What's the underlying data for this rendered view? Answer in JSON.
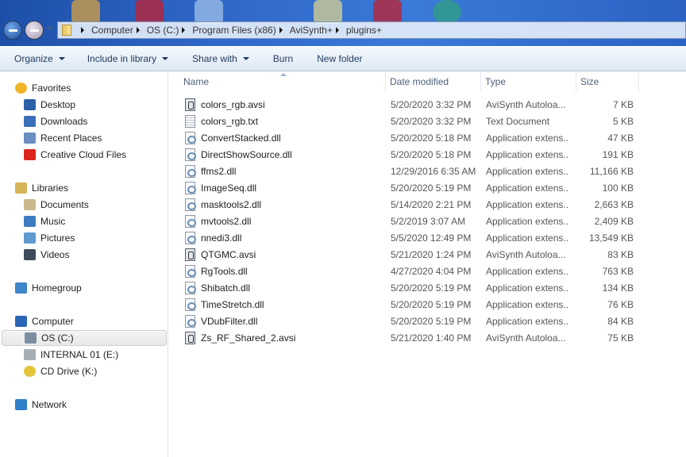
{
  "address": {
    "crumbs": [
      "Computer",
      "OS (C:)",
      "Program Files (x86)",
      "AviSynth+",
      "plugins+"
    ]
  },
  "toolbar": {
    "organize": "Organize",
    "include": "Include in library",
    "share": "Share with",
    "burn": "Burn",
    "new_folder": "New folder"
  },
  "sidebar": [
    {
      "label": "Favorites",
      "icon": "star-icon",
      "level": 0,
      "color": "#f0b429"
    },
    {
      "label": "Desktop",
      "icon": "desktop-icon",
      "level": 1,
      "color": "#2c5fa8"
    },
    {
      "label": "Downloads",
      "icon": "downloads-folder-icon",
      "level": 1,
      "color": "#3a6fb8"
    },
    {
      "label": "Recent Places",
      "icon": "recent-places-icon",
      "level": 1,
      "color": "#6a8fc0"
    },
    {
      "label": "Creative Cloud Files",
      "icon": "creative-cloud-icon",
      "level": 1,
      "color": "#d9251c"
    },
    {
      "label": "Libraries",
      "icon": "libraries-icon",
      "level": 0,
      "color": "#d7b45a",
      "gap": true
    },
    {
      "label": "Documents",
      "icon": "documents-icon",
      "level": 1,
      "color": "#c9b98a"
    },
    {
      "label": "Music",
      "icon": "music-icon",
      "level": 1,
      "color": "#3e7cc2"
    },
    {
      "label": "Pictures",
      "icon": "pictures-icon",
      "level": 1,
      "color": "#5f9bd0"
    },
    {
      "label": "Videos",
      "icon": "videos-icon",
      "level": 1,
      "color": "#3d4a5a"
    },
    {
      "label": "Homegroup",
      "icon": "homegroup-icon",
      "level": 0,
      "color": "#3d86c9",
      "gap": true
    },
    {
      "label": "Computer",
      "icon": "computer-icon",
      "level": 0,
      "color": "#2a64b5",
      "gap": true
    },
    {
      "label": "OS (C:)",
      "icon": "os-drive-icon",
      "level": 1,
      "color": "#7d8ea0",
      "selected": true
    },
    {
      "label": "INTERNAL 01 (E:)",
      "icon": "hard-drive-icon",
      "level": 1,
      "color": "#a7adb5"
    },
    {
      "label": "CD Drive (K:)",
      "icon": "cd-drive-icon",
      "level": 1,
      "color": "#e3c43b"
    },
    {
      "label": "Network",
      "icon": "network-icon",
      "level": 0,
      "color": "#2f7fc9",
      "gap": true
    }
  ],
  "columns": {
    "name": "Name",
    "date": "Date modified",
    "type": "Type",
    "size": "Size"
  },
  "files": [
    {
      "name": "colors_rgb.avsi",
      "date": "5/20/2020 3:32 PM",
      "type": "AviSynth Autoloa...",
      "size": "7 KB",
      "kind": "avsi"
    },
    {
      "name": "colors_rgb.txt",
      "date": "5/20/2020 3:32 PM",
      "type": "Text Document",
      "size": "5 KB",
      "kind": "txt"
    },
    {
      "name": "ConvertStacked.dll",
      "date": "5/20/2020 5:18 PM",
      "type": "Application extens...",
      "size": "47 KB",
      "kind": "dll"
    },
    {
      "name": "DirectShowSource.dll",
      "date": "5/20/2020 5:18 PM",
      "type": "Application extens...",
      "size": "191 KB",
      "kind": "dll"
    },
    {
      "name": "ffms2.dll",
      "date": "12/29/2016 6:35 AM",
      "type": "Application extens...",
      "size": "11,166 KB",
      "kind": "dll"
    },
    {
      "name": "ImageSeq.dll",
      "date": "5/20/2020 5:19 PM",
      "type": "Application extens...",
      "size": "100 KB",
      "kind": "dll"
    },
    {
      "name": "masktools2.dll",
      "date": "5/14/2020 2:21 PM",
      "type": "Application extens...",
      "size": "2,663 KB",
      "kind": "dll"
    },
    {
      "name": "mvtools2.dll",
      "date": "5/2/2019 3:07 AM",
      "type": "Application extens...",
      "size": "2,409 KB",
      "kind": "dll"
    },
    {
      "name": "nnedi3.dll",
      "date": "5/5/2020 12:49 PM",
      "type": "Application extens...",
      "size": "13,549 KB",
      "kind": "dll"
    },
    {
      "name": "QTGMC.avsi",
      "date": "5/21/2020 1:24 PM",
      "type": "AviSynth Autoloa...",
      "size": "83 KB",
      "kind": "avsi"
    },
    {
      "name": "RgTools.dll",
      "date": "4/27/2020 4:04 PM",
      "type": "Application extens...",
      "size": "763 KB",
      "kind": "dll"
    },
    {
      "name": "Shibatch.dll",
      "date": "5/20/2020 5:19 PM",
      "type": "Application extens...",
      "size": "134 KB",
      "kind": "dll"
    },
    {
      "name": "TimeStretch.dll",
      "date": "5/20/2020 5:19 PM",
      "type": "Application extens...",
      "size": "76 KB",
      "kind": "dll"
    },
    {
      "name": "VDubFilter.dll",
      "date": "5/20/2020 5:19 PM",
      "type": "Application extens...",
      "size": "84 KB",
      "kind": "dll"
    },
    {
      "name": "Zs_RF_Shared_2.avsi",
      "date": "5/21/2020 1:40 PM",
      "type": "AviSynth Autoloa...",
      "size": "75 KB",
      "kind": "avsi"
    }
  ]
}
